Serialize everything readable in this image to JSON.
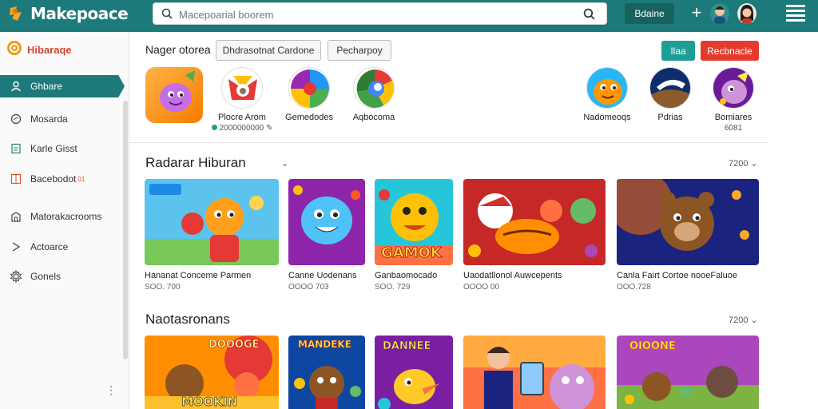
{
  "app": {
    "name": "Makepoace"
  },
  "search": {
    "placeholder": "Macepoarial boorem"
  },
  "header": {
    "button_label": "Bdaine"
  },
  "sidebar": {
    "header_label": "Hibaraqe",
    "items": [
      {
        "label": "Ghbare",
        "icon": "person-icon",
        "active": true
      },
      {
        "label": "Mosarda",
        "icon": "circle-icon"
      },
      {
        "label": "Karle Gisst",
        "icon": "document-icon"
      },
      {
        "label": "Bacebodot",
        "icon": "grid-icon",
        "badge": "01"
      },
      {
        "label": "Matorakacrooms",
        "icon": "building-icon"
      },
      {
        "label": "Actoarce",
        "icon": "arrow-icon"
      },
      {
        "label": "Gonels",
        "icon": "gear-icon"
      }
    ]
  },
  "featured": {
    "title": "Nager otorea",
    "chips": [
      "Dhdrasotnat Cardone",
      "Pecharpoy"
    ],
    "btn_primary": "Ilaa",
    "btn_danger": "Recbnacle",
    "apps": [
      {
        "label": "Plocre Arom",
        "sub": "2000000000"
      },
      {
        "label": "Gemedodes"
      },
      {
        "label": "Aqbocoma"
      },
      {
        "label": "Nadomeoqs"
      },
      {
        "label": "Pdrias"
      },
      {
        "label": "Bomiares",
        "sub": "6081"
      }
    ]
  },
  "section1": {
    "title": "Radarar Hiburan",
    "more": "7200",
    "cards": [
      {
        "title": "Hananat Conceme Parmen",
        "sub": "SOO. 700"
      },
      {
        "title": "Canne Uodenans",
        "sub": "OOOO 703"
      },
      {
        "title": "Ganbaomocado",
        "sub": "SOO. 729",
        "banner": "GAMOK"
      },
      {
        "title": "Uaodatllonol Auwcepents",
        "sub": "OOOO 00"
      },
      {
        "title": "Canla Fairt Cortoe nooeFaluoe",
        "sub": "OOO.728"
      }
    ]
  },
  "section2": {
    "title": "Naotasronans",
    "more": "7200",
    "banners": [
      "DOOOGE",
      "MANDEKE",
      "DANNEE",
      "",
      "OIOONE"
    ],
    "banner_sub": "MOOKIN"
  },
  "colors": {
    "brand": "#1c7a7a",
    "danger": "#e53b2e",
    "accent": "#1f9e96"
  }
}
